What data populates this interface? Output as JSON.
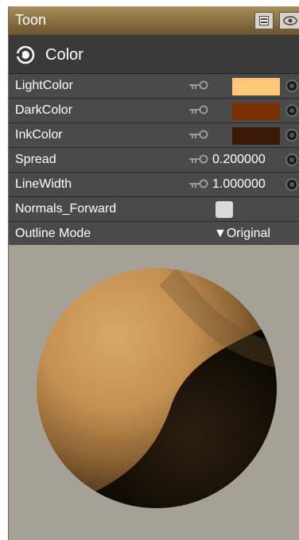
{
  "panel": {
    "title": "Toon",
    "group": "Color"
  },
  "properties": [
    {
      "label": "LightColor",
      "type": "color",
      "color": "#ffc879"
    },
    {
      "label": "DarkColor",
      "type": "color",
      "color": "#7a2f00"
    },
    {
      "label": "InkColor",
      "type": "color",
      "color": "#3a1a06"
    },
    {
      "label": "Spread",
      "type": "number",
      "value": "0.200000"
    },
    {
      "label": "LineWidth",
      "type": "number",
      "value": "1.000000"
    },
    {
      "label": "Normals_Forward",
      "type": "checkbox",
      "checked": false
    },
    {
      "label": "Outline Mode",
      "type": "dropdown",
      "value": "Original",
      "marker": "▼"
    }
  ],
  "colors": {
    "title_bar": "#8c7344",
    "row_bg": "#4a4a4a",
    "preview_bg": "#a6a196"
  }
}
